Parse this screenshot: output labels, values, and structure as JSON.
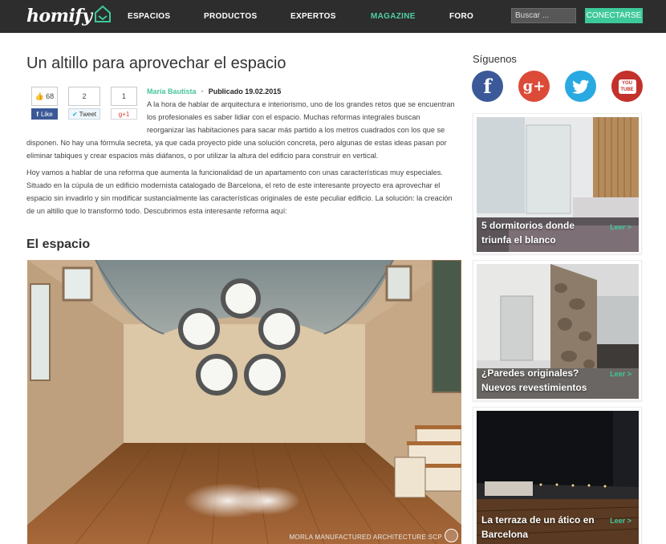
{
  "header": {
    "logo": "homify",
    "nav": [
      "ESPACIOS",
      "PRODUCTOS",
      "EXPERTOS",
      "MAGAZINE",
      "FORO"
    ],
    "active_nav": "MAGAZINE",
    "search_placeholder": "Buscar ...",
    "connect_label": "CONECTARSE"
  },
  "article": {
    "title": "Un altillo para aprovechar el espacio",
    "share": {
      "fb_count": "68",
      "fb_label": "Like",
      "tw_count": "2",
      "tw_label": "Tweet",
      "gp_count": "1",
      "gp_label": "g+1"
    },
    "author": "María Bautista",
    "published": "Publicado 19.02.2015",
    "intro_lines": [
      "A la hora de hablar de arquitectura e interiorismo, uno de los grandes retos que se encuentran",
      "los profesionales es saber lidiar con el espacio. Muchas reformas integrales buscan",
      "reorganizar las habitaciones para sacar más partido a los metros cuadrados con los que se"
    ],
    "intro_rest": [
      "disponen. No hay una fórmula secreta, ya que cada proyecto pide una solución concreta, pero algunas de estas ideas pasan por",
      "eliminar tabiques y crear espacios más diáfanos, o por utilizar la altura del edificio para construir en vertical."
    ],
    "para2": [
      "Hoy vamos a hablar de una reforma que aumenta la funcionalidad de un apartamento con unas características muy especiales.",
      "Situado en la cúpula de un edificio modernista catalogado de Barcelona, el reto de este interesante proyecto era aprovechar el",
      "espacio sin invadirlo y sin modificar sustancialmente las características originales de este peculiar edificio. La solución: la creación",
      "de un altillo que lo transformó todo. Descubrimos esta interesante reforma aquí:"
    ],
    "section_title": "El espacio",
    "photo_credit": "MORLA MANUFACTURED ARCHITECTURE SCP"
  },
  "sidebar": {
    "follow_label": "Síguenos",
    "social": [
      {
        "name": "facebook",
        "glyph": "f",
        "color": "#3b5998"
      },
      {
        "name": "google-plus",
        "glyph": "g+",
        "color": "#dc4a38"
      },
      {
        "name": "twitter",
        "glyph": "🐦",
        "color": "#29a9e1"
      },
      {
        "name": "youtube",
        "glyph": "YOU TUBE",
        "color": "#c4302b"
      }
    ],
    "cards": [
      {
        "line1": "5 dormitorios donde",
        "line2": "triunfa el blanco",
        "leer": "Leer >"
      },
      {
        "line1": "¿Paredes originales?",
        "line2": "Nuevos revestimientos",
        "leer": "Leer >"
      },
      {
        "line1": "La terraza de un ático en",
        "line2": "Barcelona",
        "leer": "Leer >"
      }
    ]
  }
}
